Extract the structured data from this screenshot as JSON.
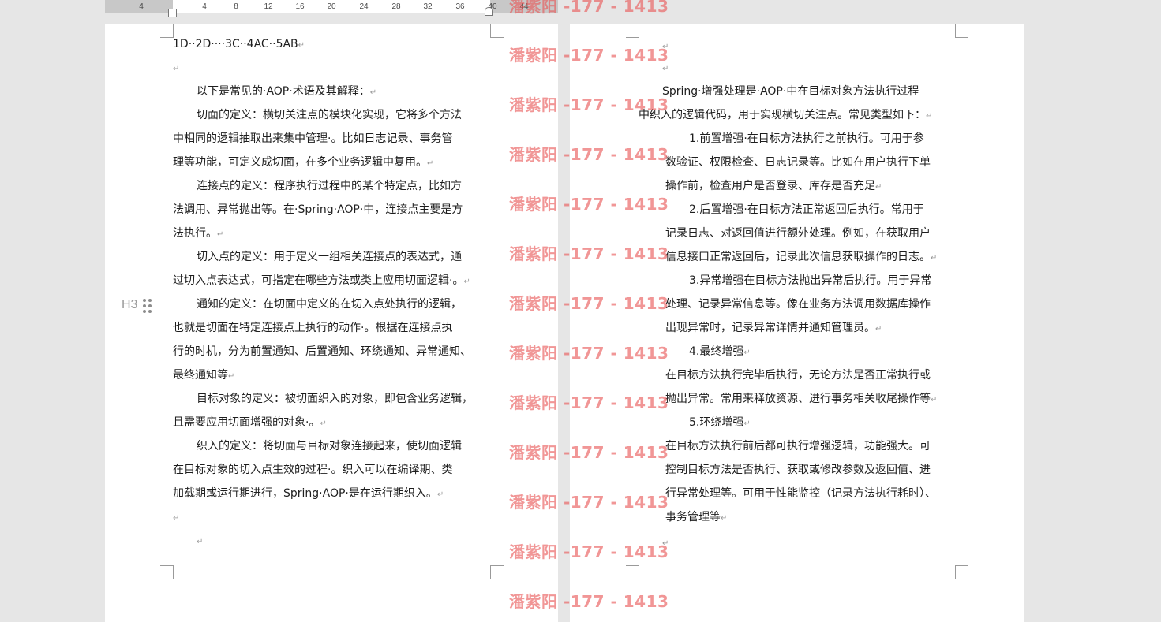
{
  "ruler": {
    "ticks": [
      "4",
      "4",
      "8",
      "12",
      "16",
      "20",
      "24",
      "28",
      "32",
      "36",
      "40",
      "44"
    ]
  },
  "heading_marker": "H3",
  "watermark": "潘紫阳 -177 - 1413",
  "page1": {
    "lines": [
      "1D··2D····3C··4AC··5AB",
      "",
      "以下是常见的·AOP·术语及其解释：",
      "切面的定义：横切关注点的模块化实现，它将多个方法",
      "中相同的逻辑抽取出来集中管理·。比如日志记录、事务管",
      "理等功能，可定义成切面，在多个业务逻辑中复用。",
      "连接点的定义：程序执行过程中的某个特定点，比如方",
      "法调用、异常抛出等。在·Spring·AOP·中，连接点主要是方",
      "法执行。",
      "切入点的定义：用于定义一组相关连接点的表达式，通",
      "过切入点表达式，可指定在哪些方法或类上应用切面逻辑·。",
      "通知的定义：在切面中定义的在切入点处执行的逻辑，",
      "也就是切面在特定连接点上执行的动作·。根据在连接点执",
      "行的时机，分为前置通知、后置通知、环绕通知、异常通知、",
      "最终通知等",
      "目标对象的定义：被切面织入的对象，即包含业务逻辑，",
      "且需要应用切面增强的对象·。",
      "织入的定义：将切面与目标对象连接起来，使切面逻辑",
      "在目标对象的切入点生效的过程·。织入可以在编译期、类",
      "加载期或运行期进行，Spring·AOP·是在运行期织入。",
      "",
      ""
    ]
  },
  "page2": {
    "lines": [
      "",
      "",
      "Spring·增强处理是·AOP·中在目标对象方法执行过程",
      "中织入的逻辑代码，用于实现横切关注点。常见类型如下：",
      "1.前置增强·在目标方法执行之前执行。可用于参",
      "数验证、权限检查、日志记录等。比如在用户执行下单",
      "操作前，检查用户是否登录、库存是否充足",
      "2.后置增强·在目标方法正常返回后执行。常用于",
      "记录日志、对返回值进行额外处理。例如，在获取用户",
      "信息接口正常返回后，记录此次信息获取操作的日志。",
      "3.异常增强在目标方法抛出异常后执行。用于异常",
      "处理、记录异常信息等。像在业务方法调用数据库操作",
      "出现异常时，记录异常详情并通知管理员。",
      "4.最终增强",
      "在目标方法执行完毕后执行，无论方法是否正常执行或",
      "抛出异常。常用来释放资源、进行事务相关收尾操作等",
      "5.环绕增强",
      "在目标方法执行前后都可执行增强逻辑，功能强大。可",
      "控制目标方法是否执行、获取或修改参数及返回值、进",
      "行异常处理等。可用于性能监控（记录方法执行耗时）、",
      "事务管理等",
      ""
    ]
  }
}
